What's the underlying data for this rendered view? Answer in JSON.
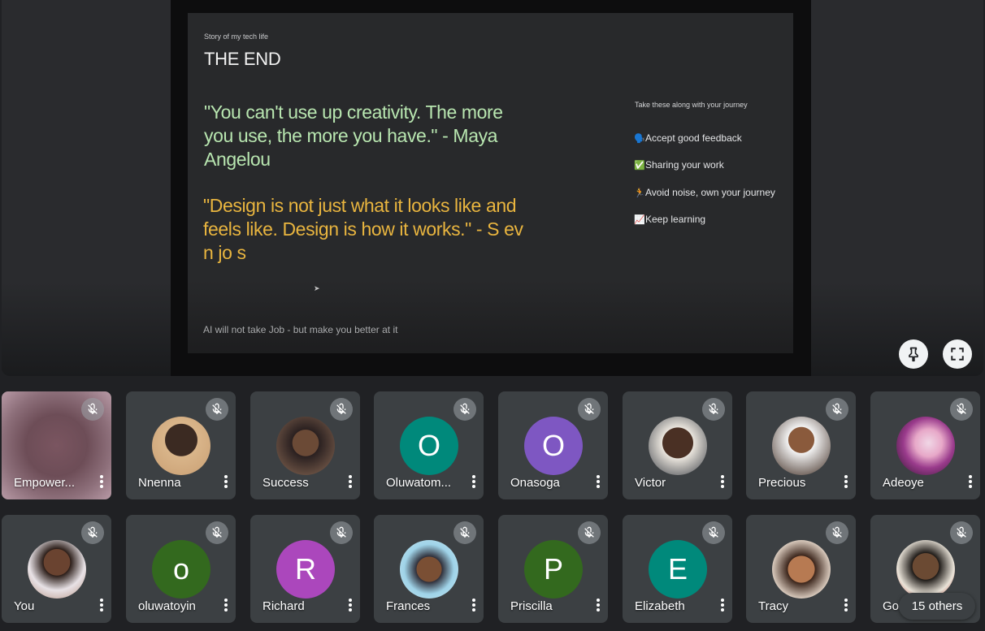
{
  "presentation": {
    "kicker": "Story of my tech life",
    "title": "THE END",
    "quote1": "\"You can't use up creativity. The more you use, the more you have.\" - Maya Angelou",
    "quote2": "\"Design is not just what it looks like and feels like. Design is how it works.\" - S ev  n jo  s",
    "footer": "AI  will not take Job - but make you better at it",
    "side_heading": "Take these along with your journey",
    "tips": [
      {
        "icon": "🗣️",
        "text": "Accept good feedback"
      },
      {
        "icon": "✅",
        "text": "Sharing your work"
      },
      {
        "icon": "🏃",
        "text": "Avoid noise, own your journey"
      },
      {
        "icon": "📈",
        "text": "Keep learning"
      }
    ]
  },
  "controls": {
    "pin_icon": "pin-icon",
    "fullscreen_icon": "fullscreen-icon"
  },
  "participants": [
    {
      "name": "Empower...",
      "initial": "",
      "photo": "self-video"
    },
    {
      "name": "Nnenna",
      "initial": "",
      "photo": "photo"
    },
    {
      "name": "Success",
      "initial": "",
      "photo": "photo"
    },
    {
      "name": "Oluwatom...",
      "initial": "O",
      "color": "#00897b"
    },
    {
      "name": "Onasoga",
      "initial": "O",
      "color": "#7e57c2"
    },
    {
      "name": "Victor",
      "initial": "",
      "photo": "photo"
    },
    {
      "name": "Precious",
      "initial": "",
      "photo": "photo"
    },
    {
      "name": "Adeoye",
      "initial": "",
      "photo": "photo"
    },
    {
      "name": "You",
      "initial": "",
      "photo": "photo"
    },
    {
      "name": "oluwatoyin",
      "initial": "o",
      "color": "#33691e"
    },
    {
      "name": "Richard",
      "initial": "R",
      "color": "#ab47bc"
    },
    {
      "name": "Frances",
      "initial": "",
      "photo": "photo"
    },
    {
      "name": "Priscilla",
      "initial": "P",
      "color": "#33691e"
    },
    {
      "name": "Elizabeth",
      "initial": "E",
      "color": "#00897b"
    },
    {
      "name": "Tracy",
      "initial": "",
      "photo": "photo"
    },
    {
      "name": "Go",
      "initial": "",
      "photo": "photo"
    }
  ],
  "others_label": "15 others",
  "colors": {
    "background": "#202124",
    "tile": "#3c4043",
    "quote_green": "#b8e6b0",
    "quote_gold": "#e9b53f"
  }
}
